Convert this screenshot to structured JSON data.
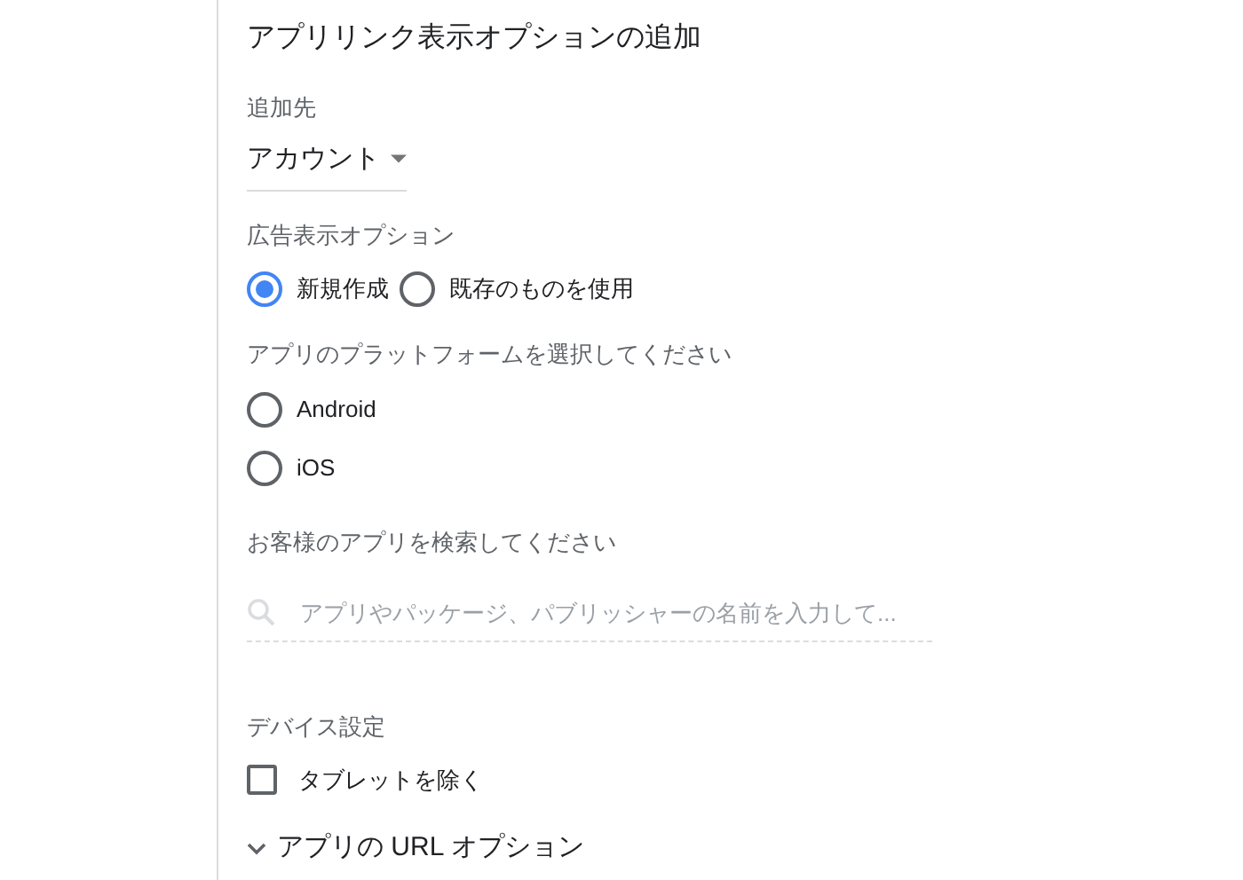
{
  "title": "アプリリンク表示オプションの追加",
  "destination": {
    "label": "追加先",
    "value": "アカウント"
  },
  "extension": {
    "label": "広告表示オプション",
    "options": [
      {
        "label": "新規作成",
        "selected": true
      },
      {
        "label": "既存のものを使用",
        "selected": false
      }
    ]
  },
  "platform": {
    "label": "アプリのプラットフォームを選択してください",
    "options": [
      {
        "label": "Android",
        "selected": false
      },
      {
        "label": "iOS",
        "selected": false
      }
    ]
  },
  "app_search": {
    "label": "お客様のアプリを検索してください",
    "placeholder": "アプリやパッケージ、パブリッシャーの名前を入力して..."
  },
  "device": {
    "label": "デバイス設定",
    "options": [
      {
        "label": "タブレットを除く",
        "checked": false
      }
    ]
  },
  "url_options": {
    "label": "アプリの URL オプション",
    "expanded": false
  }
}
